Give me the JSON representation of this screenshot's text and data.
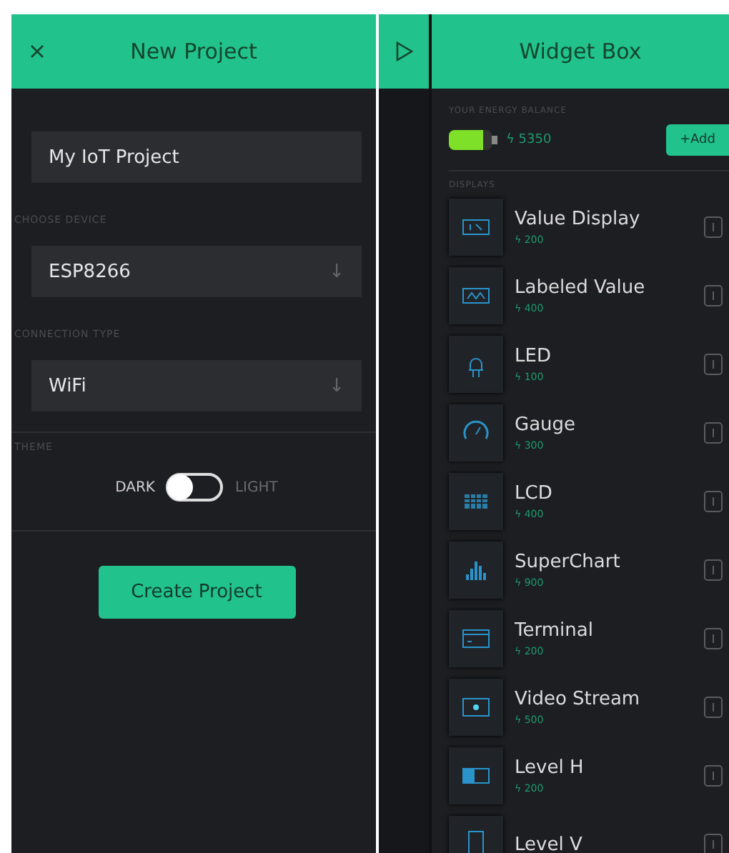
{
  "new_project": {
    "title": "New Project",
    "name_field": {
      "value": "My IoT Project"
    },
    "device": {
      "label": "CHOOSE DEVICE",
      "value": "ESP8266",
      "arrow": "↓"
    },
    "connection": {
      "label": "CONNECTION TYPE",
      "value": "WiFi",
      "arrow": "↓"
    },
    "theme": {
      "label": "THEME",
      "options": [
        {
          "label": "DARK",
          "selected": true
        },
        {
          "label": "LIGHT",
          "selected": false
        }
      ]
    },
    "create_button": "Create Project"
  },
  "widget_box": {
    "title": "Widget Box",
    "energy": {
      "label": "YOUR ENERGY BALANCE",
      "level": 0.8,
      "value": "ϟ 5350"
    },
    "add_button": "+Add",
    "section": "DISPLAYS",
    "widgets": [
      {
        "kind": "value",
        "name": "Value Display",
        "price": "ϟ 200"
      },
      {
        "kind": "labeled",
        "name": "Labeled Value",
        "price": "ϟ 400"
      },
      {
        "kind": "led",
        "name": "LED",
        "price": "ϟ 100"
      },
      {
        "kind": "gauge",
        "name": "Gauge",
        "price": "ϟ 300"
      },
      {
        "kind": "lcd",
        "name": "LCD",
        "price": "ϟ 400"
      },
      {
        "kind": "chart",
        "name": "SuperChart",
        "price": "ϟ 900"
      },
      {
        "kind": "terminal",
        "name": "Terminal",
        "price": "ϟ 200"
      },
      {
        "kind": "video",
        "name": "Video Stream",
        "price": "ϟ 500"
      },
      {
        "kind": "level_h",
        "name": "Level H",
        "price": "ϟ 200"
      },
      {
        "kind": "level_v",
        "name": "Level V"
      }
    ]
  }
}
